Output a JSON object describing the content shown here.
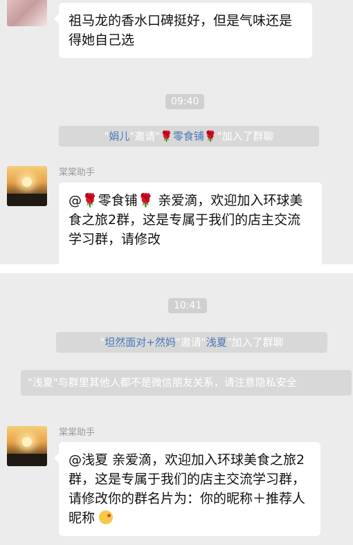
{
  "top": {
    "first_message": "祖马龙的香水口碑挺好，但是气味还是得她自己选",
    "time": "09:40",
    "invite": {
      "q1": "\"",
      "inviter": "娟儿",
      "mid": "\"邀请\"",
      "rose1": "🌹",
      "invitee": "零食铺",
      "rose2": "🌹",
      "end": "\"加入了群聊"
    },
    "sender": "棠棠助手",
    "welcome_at": "@",
    "welcome_rose1": "🌹",
    "welcome_name": "零食铺",
    "welcome_rose2": "🌹",
    "welcome_text": " 亲爱滴，欢迎加入环球美食之旅2群，这是专属于我们的店主交流学习群，请修改"
  },
  "bottom": {
    "time": "10:41",
    "invite": {
      "q1": "\"",
      "inviter": "坦然面对+然妈",
      "mid": "\"邀请\"",
      "invitee": "浅夏",
      "end": "\"加入了群聊"
    },
    "privacy_notice": "\"浅夏\"与群里其他人都不是微信朋友关系，请注意隐私安全",
    "sender": "棠棠助手",
    "welcome_text": "@浅夏 亲爱滴，欢迎加入环球美食之旅2群，这是专属于我们的店主交流学习群，请修改你的群名片为：你的昵称＋推荐人昵称",
    "emoji_icon": "kiss-emoji"
  }
}
